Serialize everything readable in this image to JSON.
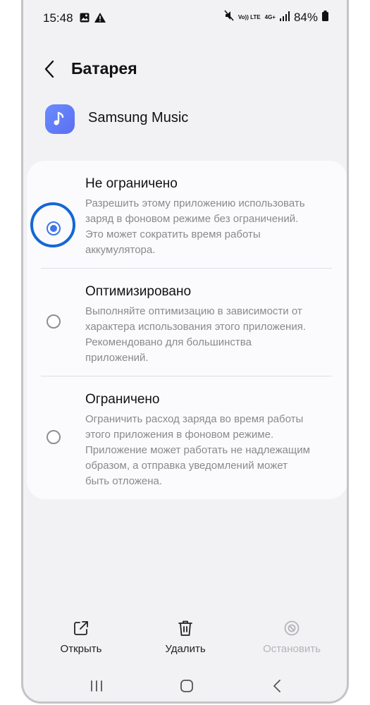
{
  "status_bar": {
    "time": "15:48",
    "network_volte": "Vo)) LTE",
    "network_type": "4G+",
    "battery": "84%"
  },
  "header": {
    "title": "Батарея"
  },
  "app": {
    "name": "Samsung Music"
  },
  "options": [
    {
      "title": "Не ограничено",
      "description": "Разрешить этому приложению использовать заряд в фоновом режиме без ограничений. Это может сократить время работы аккумулятора.",
      "selected": true
    },
    {
      "title": "Оптимизировано",
      "description": "Выполняйте оптимизацию в зависимости от характера использования этого приложения. Рекомендовано для большинства приложений.",
      "selected": false
    },
    {
      "title": "Ограничено",
      "description": "Ограничить расход заряда во время работы этого приложения в фоновом режиме. Приложение может работать не надлежащим образом, а отправка уведомлений может быть отложена.",
      "selected": false
    }
  ],
  "bottom_actions": {
    "open": "Открыть",
    "delete": "Удалить",
    "stop": "Остановить"
  },
  "colors": {
    "accent": "#3e75e8",
    "highlight_ring": "#1467d6",
    "background": "#f2f2f5",
    "card": "#fbfbfd"
  },
  "icons": {
    "back": "chevron-left-icon",
    "app": "music-note-icon",
    "open": "open-external-icon",
    "delete": "trash-icon",
    "stop": "stop-icon"
  }
}
